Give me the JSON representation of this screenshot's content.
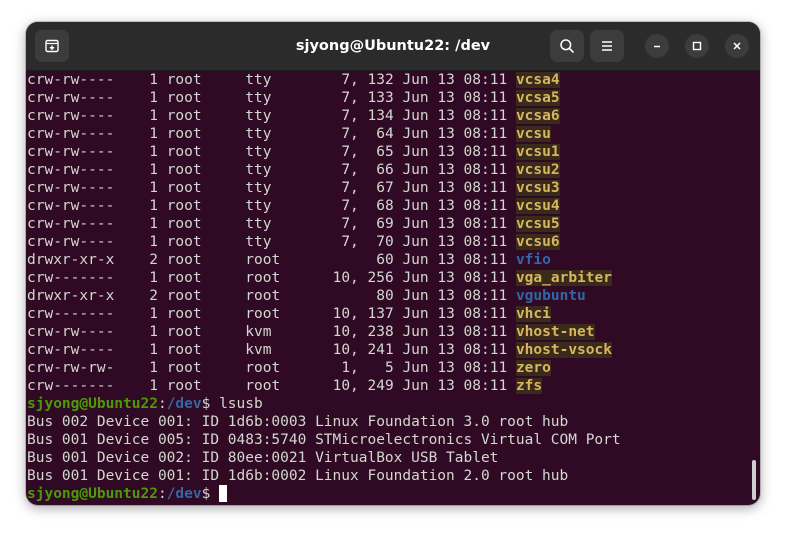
{
  "window": {
    "title": "sjyong@Ubuntu22: /dev"
  },
  "header": {
    "new_tab_icon": "new-tab-icon",
    "search_icon": "search-icon",
    "menu_icon": "hamburger-menu-icon",
    "minimize_icon": "minimize-icon",
    "maximize_icon": "maximize-icon",
    "close_icon": "close-icon"
  },
  "colors": {
    "terminal_bg": "#300a24",
    "headerbar_bg": "#2b2b2b",
    "text": "#d3d7cf",
    "prompt_user": "#4e9a06",
    "prompt_path": "#3465a4",
    "device_name": "#d7b65d",
    "directory": "#3465a4"
  },
  "terminal": {
    "listing": [
      {
        "perm": "crw-rw----",
        "links": "1",
        "owner": "root",
        "group": "tty",
        "size": "7, 132",
        "date": "Jun 13 08:11",
        "name": "vcsa4",
        "kind": "dev"
      },
      {
        "perm": "crw-rw----",
        "links": "1",
        "owner": "root",
        "group": "tty",
        "size": "7, 133",
        "date": "Jun 13 08:11",
        "name": "vcsa5",
        "kind": "dev"
      },
      {
        "perm": "crw-rw----",
        "links": "1",
        "owner": "root",
        "group": "tty",
        "size": "7, 134",
        "date": "Jun 13 08:11",
        "name": "vcsa6",
        "kind": "dev"
      },
      {
        "perm": "crw-rw----",
        "links": "1",
        "owner": "root",
        "group": "tty",
        "size": "7,  64",
        "date": "Jun 13 08:11",
        "name": "vcsu",
        "kind": "dev"
      },
      {
        "perm": "crw-rw----",
        "links": "1",
        "owner": "root",
        "group": "tty",
        "size": "7,  65",
        "date": "Jun 13 08:11",
        "name": "vcsu1",
        "kind": "dev"
      },
      {
        "perm": "crw-rw----",
        "links": "1",
        "owner": "root",
        "group": "tty",
        "size": "7,  66",
        "date": "Jun 13 08:11",
        "name": "vcsu2",
        "kind": "dev"
      },
      {
        "perm": "crw-rw----",
        "links": "1",
        "owner": "root",
        "group": "tty",
        "size": "7,  67",
        "date": "Jun 13 08:11",
        "name": "vcsu3",
        "kind": "dev"
      },
      {
        "perm": "crw-rw----",
        "links": "1",
        "owner": "root",
        "group": "tty",
        "size": "7,  68",
        "date": "Jun 13 08:11",
        "name": "vcsu4",
        "kind": "dev"
      },
      {
        "perm": "crw-rw----",
        "links": "1",
        "owner": "root",
        "group": "tty",
        "size": "7,  69",
        "date": "Jun 13 08:11",
        "name": "vcsu5",
        "kind": "dev"
      },
      {
        "perm": "crw-rw----",
        "links": "1",
        "owner": "root",
        "group": "tty",
        "size": "7,  70",
        "date": "Jun 13 08:11",
        "name": "vcsu6",
        "kind": "dev"
      },
      {
        "perm": "drwxr-xr-x",
        "links": "2",
        "owner": "root",
        "group": "root",
        "size": "60",
        "date": "Jun 13 08:11",
        "name": "vfio",
        "kind": "dir"
      },
      {
        "perm": "crw-------",
        "links": "1",
        "owner": "root",
        "group": "root",
        "size": "10, 256",
        "date": "Jun 13 08:11",
        "name": "vga_arbiter",
        "kind": "dev"
      },
      {
        "perm": "drwxr-xr-x",
        "links": "2",
        "owner": "root",
        "group": "root",
        "size": "80",
        "date": "Jun 13 08:11",
        "name": "vgubuntu",
        "kind": "dir"
      },
      {
        "perm": "crw-------",
        "links": "1",
        "owner": "root",
        "group": "root",
        "size": "10, 137",
        "date": "Jun 13 08:11",
        "name": "vhci",
        "kind": "dev"
      },
      {
        "perm": "crw-rw----",
        "links": "1",
        "owner": "root",
        "group": "kvm",
        "size": "10, 238",
        "date": "Jun 13 08:11",
        "name": "vhost-net",
        "kind": "dev"
      },
      {
        "perm": "crw-rw----",
        "links": "1",
        "owner": "root",
        "group": "kvm",
        "size": "10, 241",
        "date": "Jun 13 08:11",
        "name": "vhost-vsock",
        "kind": "dev"
      },
      {
        "perm": "crw-rw-rw-",
        "links": "1",
        "owner": "root",
        "group": "root",
        "size": "1,   5",
        "date": "Jun 13 08:11",
        "name": "zero",
        "kind": "dev"
      },
      {
        "perm": "crw-------",
        "links": "1",
        "owner": "root",
        "group": "root",
        "size": "10, 249",
        "date": "Jun 13 08:11",
        "name": "zfs",
        "kind": "dev"
      }
    ],
    "prompt": {
      "user_host": "sjyong@Ubuntu22",
      "sep": ":",
      "path": "/dev",
      "symbol": "$"
    },
    "command": "lsusb",
    "output": [
      "Bus 002 Device 001: ID 1d6b:0003 Linux Foundation 3.0 root hub",
      "Bus 001 Device 005: ID 0483:5740 STMicroelectronics Virtual COM Port",
      "Bus 001 Device 002: ID 80ee:0021 VirtualBox USB Tablet",
      "Bus 001 Device 001: ID 1d6b:0002 Linux Foundation 2.0 root hub"
    ]
  }
}
